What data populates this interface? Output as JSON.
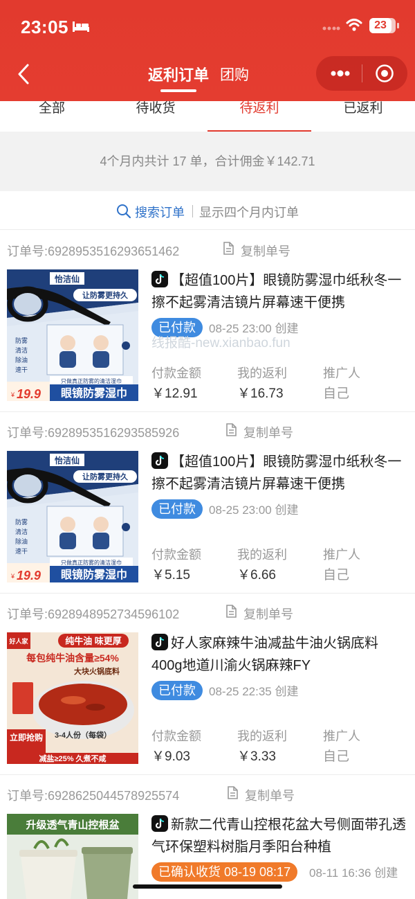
{
  "status_bar": {
    "time": "23:05",
    "battery": "23"
  },
  "nav": {
    "title": "返利订单",
    "secondary_title": "团购"
  },
  "tabs": [
    {
      "label": "全部",
      "active": false
    },
    {
      "label": "待收货",
      "active": false
    },
    {
      "label": "待返利",
      "active": true
    },
    {
      "label": "已返利",
      "active": false
    }
  ],
  "summary": {
    "text": "4个月内共计 17 单，合计佣金￥142.71"
  },
  "search": {
    "label": "搜索订单",
    "hint": "显示四个月内订单"
  },
  "copy_label": "复制单号",
  "stat_labels": {
    "paid": "付款金额",
    "rebate": "我的返利",
    "promoter": "推广人"
  },
  "watermark": "线报酷-new.xianbao.fun",
  "orders": [
    {
      "order_id": "订单号:6928953516293651462",
      "title": "【超值100片】眼镜防雾湿巾纸秋冬一擦不起雾清洁镜片屏幕速干便携",
      "status": "已付款",
      "time": "08-25 23:00 创建",
      "paid": "￥12.91",
      "rebate": "￥16.73",
      "promoter": "自己",
      "thumb": {
        "brand": "怡洁仙",
        "headline": "让防雾更持久",
        "footer": "眼镜防雾湿巾",
        "price": "19.9",
        "features": [
          "防雾",
          "清洁",
          "除油",
          "速干"
        ],
        "tagline": "只做真正防雾的清洁湿巾"
      }
    },
    {
      "order_id": "订单号:6928953516293585926",
      "title": "【超值100片】眼镜防雾湿巾纸秋冬一擦不起雾清洁镜片屏幕速干便携",
      "status": "已付款",
      "time": "08-25 23:00 创建",
      "paid": "￥5.15",
      "rebate": "￥6.66",
      "promoter": "自己",
      "thumb": {
        "brand": "怡洁仙",
        "headline": "让防雾更持久",
        "footer": "眼镜防雾湿巾",
        "price": "19.9",
        "features": [
          "防雾",
          "清洁",
          "除油",
          "速干"
        ],
        "tagline": "只做真正防雾的清洁湿巾"
      }
    },
    {
      "order_id": "订单号:6928948952734596102",
      "title": "好人家麻辣牛油减盐牛油火锅底料400g地道川渝火锅麻辣FY",
      "status": "已付款",
      "time": "08-25 22:35 创建",
      "paid": "￥9.03",
      "rebate": "￥3.33",
      "promoter": "自己",
      "thumb": {
        "brand": "好人家",
        "top_tag": "纯牛油 味更厚",
        "headline": "每包纯牛油含量≥54%",
        "sub": "大块火锅底料",
        "serving": "3-4人份（每袋）",
        "badge": "立即抢购",
        "footer": "减盐≥25% 久煮不咸"
      }
    },
    {
      "order_id": "订单号:6928625044578925574",
      "title": "新款二代青山控根花盆大号侧面带孔透气环保塑料树脂月季阳台种植",
      "status": "已确认收货 08-19 08:17",
      "time": "08-11 16:36 创建",
      "paid": "",
      "rebate": "",
      "promoter": "",
      "thumb": {
        "headline": "升级透气青山控根盆"
      }
    }
  ]
}
